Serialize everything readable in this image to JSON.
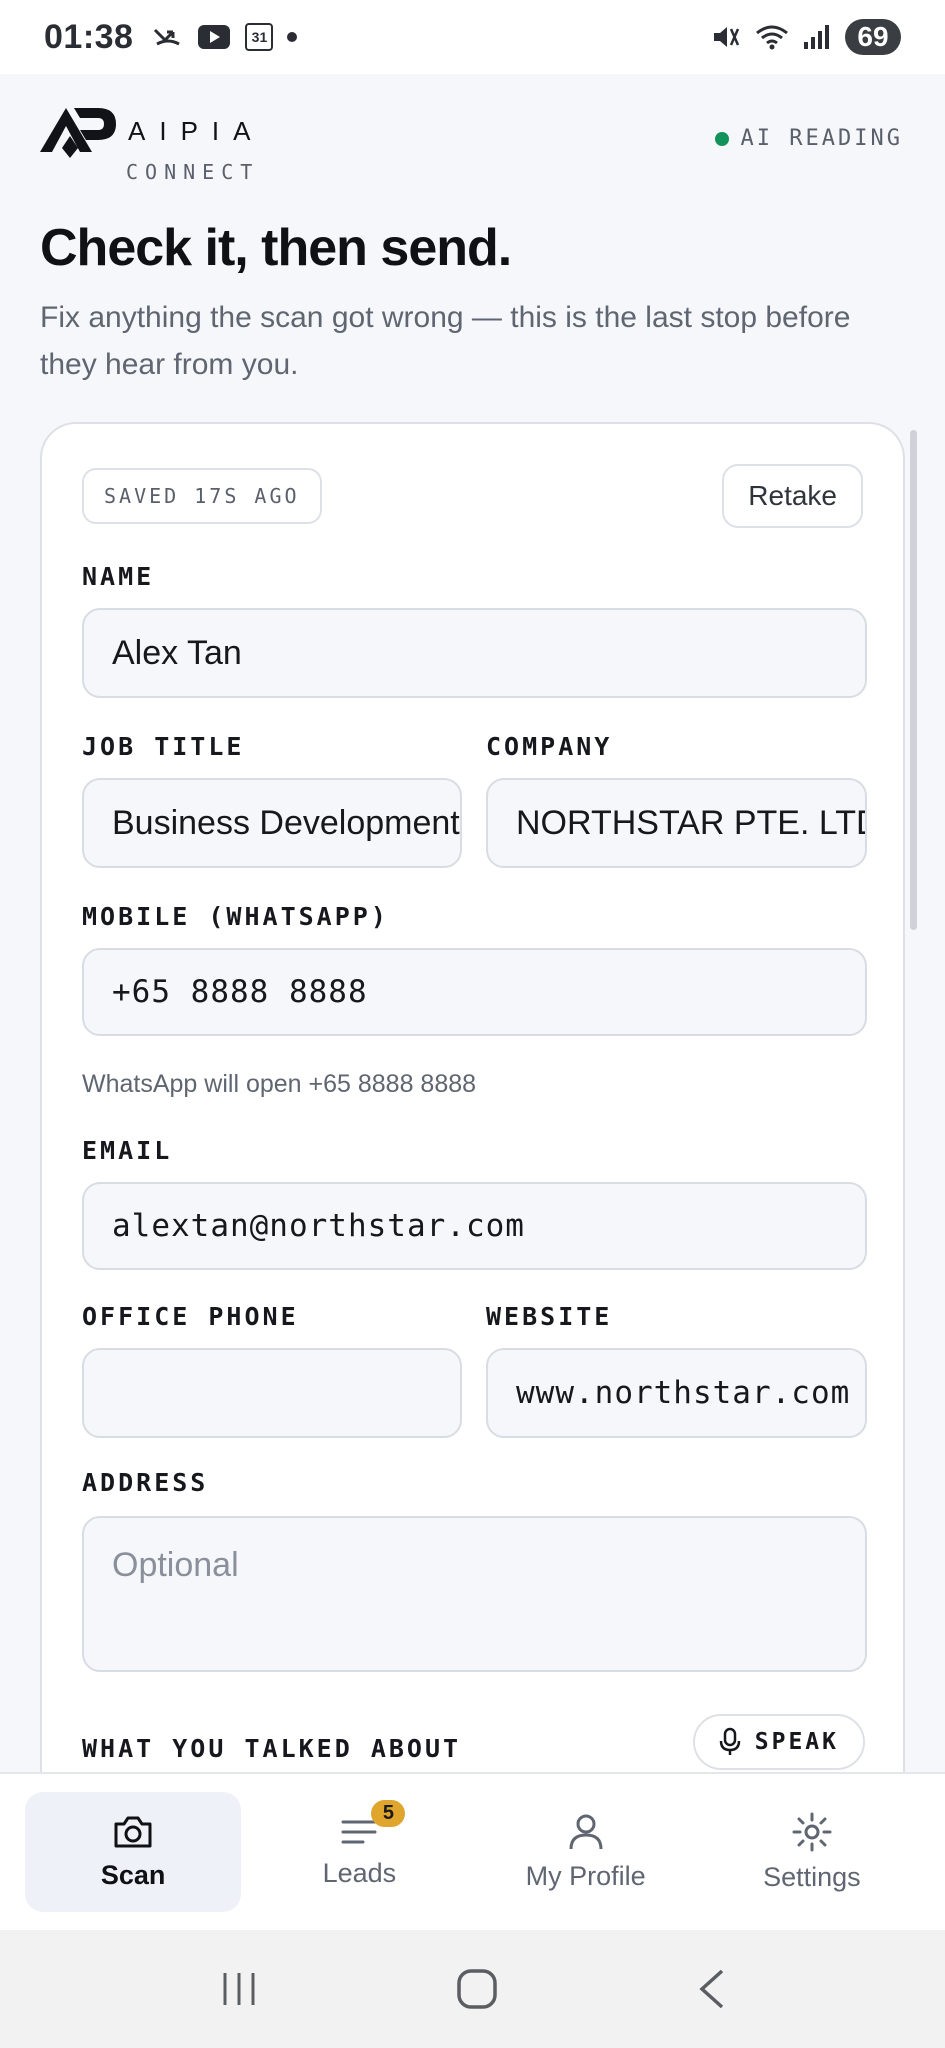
{
  "status_bar": {
    "time": "01:38",
    "calendar_day": "31",
    "battery": "69"
  },
  "header": {
    "brand_name": "AIPIA",
    "brand_sub": "CONNECT",
    "ai_status": "AI READING",
    "status_color": "#14925b"
  },
  "title": "Check it, then send.",
  "subtitle": "Fix anything the scan got wrong — this is the last stop before they hear from you.",
  "card": {
    "saved_label": "SAVED 17S AGO",
    "retake_label": "Retake",
    "fields": {
      "name": {
        "label": "NAME",
        "value": "Alex Tan"
      },
      "job_title": {
        "label": "JOB TITLE",
        "value": "Business Development Manager"
      },
      "company": {
        "label": "COMPANY",
        "value": "NORTHSTAR PTE. LTD."
      },
      "mobile": {
        "label": "MOBILE (WHATSAPP)",
        "value": "+65 8888 8888",
        "hint": "WhatsApp will open +65 8888 8888"
      },
      "email": {
        "label": "EMAIL",
        "value": "alextan@northstar.com"
      },
      "office_phone": {
        "label": "OFFICE PHONE",
        "value": ""
      },
      "website": {
        "label": "WEBSITE",
        "value": "www.northstar.com"
      },
      "address": {
        "label": "ADDRESS",
        "placeholder": "Optional"
      },
      "talked_about": {
        "label": "WHAT YOU TALKED ABOUT"
      }
    },
    "speak_label": "SPEAK"
  },
  "bottom_nav": {
    "items": [
      {
        "label": "Scan",
        "icon": "camera-icon",
        "active": true
      },
      {
        "label": "Leads",
        "icon": "list-icon",
        "badge": "5"
      },
      {
        "label": "My Profile",
        "icon": "user-icon"
      },
      {
        "label": "Settings",
        "icon": "gear-icon"
      }
    ],
    "accent_badge_color": "#e0a52c"
  }
}
